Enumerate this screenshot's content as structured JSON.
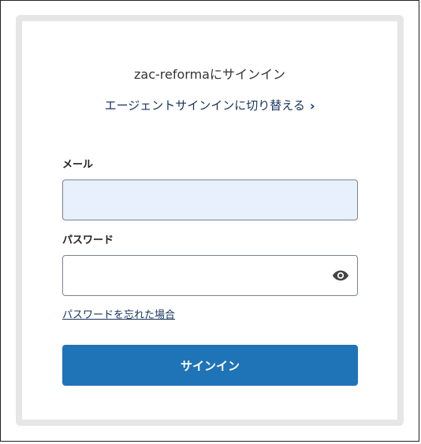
{
  "login": {
    "title": "zac-reformaにサインイン",
    "switch_link": "エージェントサインインに切り替える",
    "switch_icon": "chevron-right-icon",
    "email_label": "メール",
    "email_value": "",
    "password_label": "パスワード",
    "password_value": "",
    "show_password_icon": "eye-icon",
    "forgot_link": "パスワードを忘れた場合",
    "submit_label": "サインイン"
  },
  "colors": {
    "button": "#1f74b8",
    "email_field_background": "#e8f0fe",
    "card_border": "#e6e6e6",
    "link": "#16325c"
  }
}
